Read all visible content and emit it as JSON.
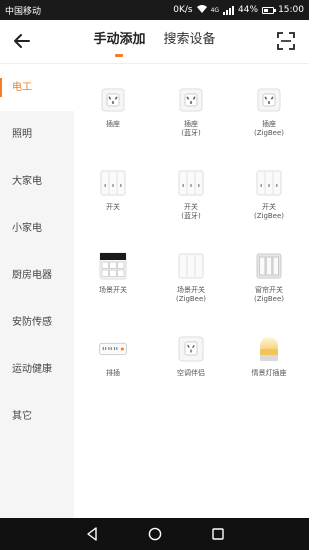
{
  "status_bar": {
    "carrier": "中国移动",
    "speed": "0K/s",
    "network": "4G",
    "battery": "44%",
    "time": "15:00"
  },
  "header": {
    "tabs": [
      {
        "label": "手动添加",
        "active": true
      },
      {
        "label": "搜索设备",
        "active": false
      }
    ],
    "back_icon": "arrow-left-icon",
    "scan_icon": "scan-icon"
  },
  "sidebar": {
    "items": [
      {
        "label": "电工",
        "active": true
      },
      {
        "label": "照明",
        "active": false
      },
      {
        "label": "大家电",
        "active": false
      },
      {
        "label": "小家电",
        "active": false
      },
      {
        "label": "厨房电器",
        "active": false
      },
      {
        "label": "安防传感",
        "active": false
      },
      {
        "label": "运动健康",
        "active": false
      },
      {
        "label": "其它",
        "active": false
      }
    ]
  },
  "devices": [
    {
      "name": "插座",
      "sub": "",
      "icon": "socket-icon"
    },
    {
      "name": "插座",
      "sub": "(蓝牙)",
      "icon": "socket-icon"
    },
    {
      "name": "插座",
      "sub": "(ZigBee)",
      "icon": "socket-icon"
    },
    {
      "name": "开关",
      "sub": "",
      "icon": "switch-icon"
    },
    {
      "name": "开关",
      "sub": "(蓝牙)",
      "icon": "switch-icon"
    },
    {
      "name": "开关",
      "sub": "(ZigBee)",
      "icon": "switch-icon"
    },
    {
      "name": "场景开关",
      "sub": "",
      "icon": "scene-switch-icon"
    },
    {
      "name": "场景开关",
      "sub": "(ZigBee)",
      "icon": "scene-switch-zigbee-icon"
    },
    {
      "name": "窗帘开关",
      "sub": "(ZigBee)",
      "icon": "curtain-switch-icon"
    },
    {
      "name": "排插",
      "sub": "",
      "icon": "power-strip-icon"
    },
    {
      "name": "空调伴侣",
      "sub": "",
      "icon": "ac-companion-icon"
    },
    {
      "name": "情景灯插座",
      "sub": "",
      "icon": "ambient-lamp-icon"
    }
  ],
  "colors": {
    "accent": "#f57c22",
    "sidebar_bg": "#f5f5f5",
    "status_bar_bg": "#1a1a1a",
    "nav_bar_bg": "#111111"
  },
  "nav_bar": {
    "icons": [
      "nav-back-icon",
      "nav-home-icon",
      "nav-recents-icon"
    ]
  }
}
